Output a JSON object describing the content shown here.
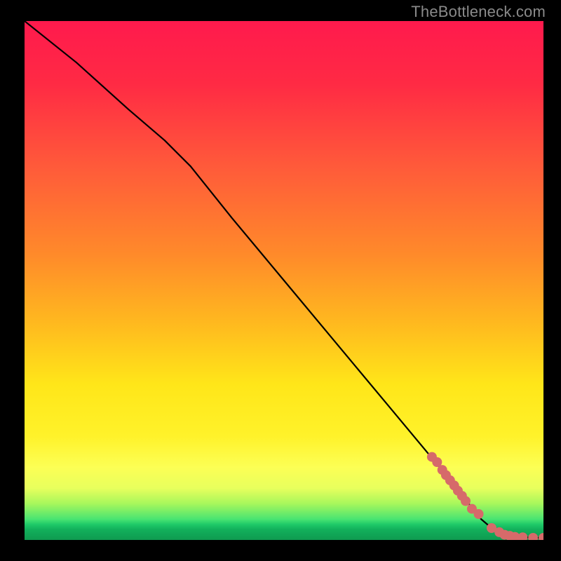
{
  "watermark": "TheBottleneck.com",
  "chart_data": {
    "type": "line",
    "title": "",
    "xlabel": "",
    "ylabel": "",
    "xlim": [
      0,
      100
    ],
    "ylim": [
      0,
      100
    ],
    "grid": false,
    "legend": false,
    "series": [
      {
        "name": "bottleneck-curve",
        "style": "line",
        "color": "#000000",
        "x": [
          0,
          10,
          20,
          27,
          32,
          40,
          50,
          60,
          70,
          80,
          84,
          88,
          90,
          92,
          94,
          100
        ],
        "y": [
          100,
          92,
          83,
          77,
          72,
          62,
          50,
          38,
          26,
          14,
          9,
          4,
          2.3,
          1.2,
          0.6,
          0.4
        ]
      },
      {
        "name": "measured-points",
        "style": "scatter",
        "color": "#d66a6a",
        "x": [
          78.5,
          79.5,
          80.5,
          81.2,
          82.0,
          82.8,
          83.5,
          84.3,
          85.0,
          86.2,
          87.5,
          90.0,
          91.5,
          92.5,
          93.5,
          94.5,
          96.0,
          98.0,
          100.0
        ],
        "y": [
          16.0,
          15.0,
          13.5,
          12.5,
          11.5,
          10.5,
          9.5,
          8.5,
          7.5,
          6.0,
          5.0,
          2.3,
          1.5,
          1.0,
          0.8,
          0.6,
          0.5,
          0.4,
          0.4
        ]
      }
    ],
    "annotations": []
  }
}
